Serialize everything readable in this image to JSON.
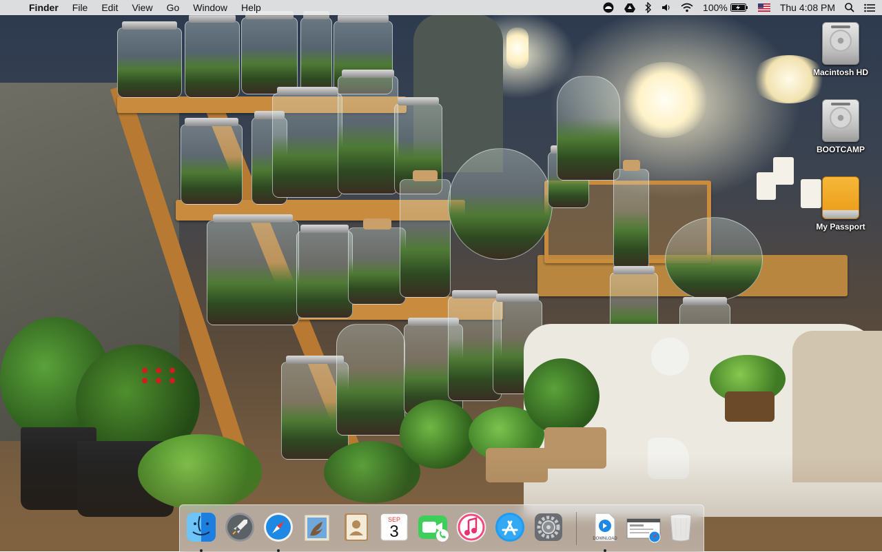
{
  "menubar": {
    "apple_symbol": "",
    "app_name": "Finder",
    "menus": [
      "File",
      "Edit",
      "View",
      "Go",
      "Window",
      "Help"
    ],
    "status": {
      "battery_percent": "100%",
      "clock": "Thu 4:08 PM",
      "icons": [
        "creative-cloud-icon",
        "google-drive-icon",
        "bluetooth-icon",
        "volume-icon",
        "wifi-icon",
        "battery-charging-icon",
        "us-flag-input-icon",
        "spotlight-search-icon",
        "notification-center-icon"
      ]
    }
  },
  "desktop": {
    "icons": [
      {
        "label": "Macintosh HD",
        "type": "internal-drive"
      },
      {
        "label": "BOOTCAMP",
        "type": "internal-drive"
      },
      {
        "label": "My Passport",
        "type": "external-drive"
      }
    ]
  },
  "dock": {
    "apps": [
      {
        "name": "Finder",
        "icon": "finder-icon",
        "running": true
      },
      {
        "name": "Launchpad",
        "icon": "launchpad-icon",
        "running": false
      },
      {
        "name": "Safari",
        "icon": "safari-icon",
        "running": true
      },
      {
        "name": "Mail",
        "icon": "mail-icon",
        "running": false
      },
      {
        "name": "Contacts",
        "icon": "contacts-icon",
        "running": false
      },
      {
        "name": "Calendar",
        "icon": "calendar-icon",
        "running": false,
        "month": "SEP",
        "day": "3"
      },
      {
        "name": "FaceTime",
        "icon": "facetime-icon",
        "running": false
      },
      {
        "name": "iTunes",
        "icon": "itunes-icon",
        "running": false
      },
      {
        "name": "App Store",
        "icon": "app-store-icon",
        "running": false
      },
      {
        "name": "System Preferences",
        "icon": "system-preferences-icon",
        "running": false
      }
    ],
    "stacks": [
      {
        "name": "Downloads",
        "icon": "downloads-stack-icon",
        "label": "DOWNLOAD",
        "running": true
      },
      {
        "name": "Safari window",
        "icon": "minimized-safari-window-icon",
        "running": false
      },
      {
        "name": "Trash",
        "icon": "trash-icon",
        "running": false
      }
    ]
  },
  "colors": {
    "menubar_bg": "#ececec",
    "passport_orange": "#ea9a16",
    "safari_blue": "#1e88e5"
  }
}
